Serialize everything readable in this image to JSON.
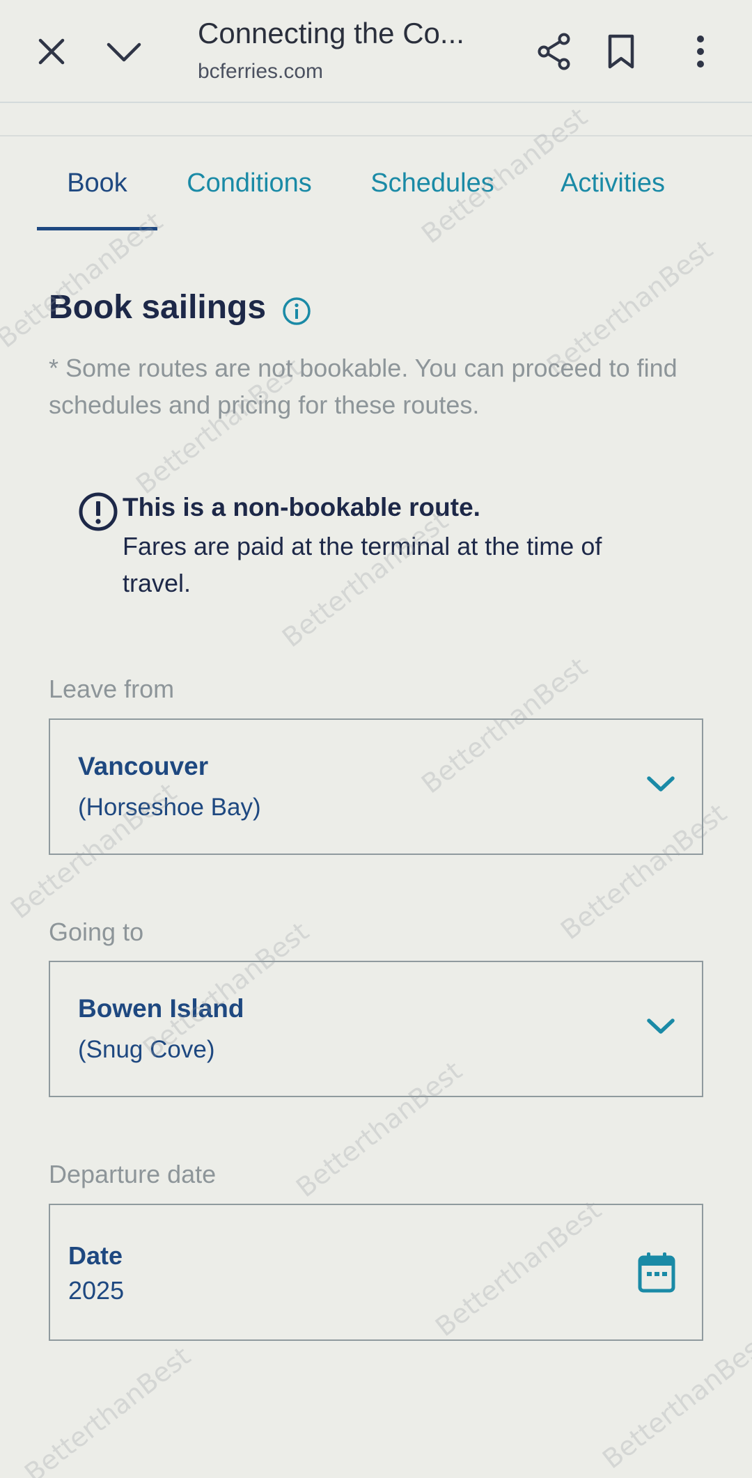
{
  "browser": {
    "page_title": "Connecting the Co...",
    "domain": "bcferries.com",
    "icons": [
      "close-icon",
      "chevron-down-icon",
      "share-icon",
      "bookmark-icon",
      "more-vert-icon"
    ]
  },
  "tabs": [
    {
      "label": "Book",
      "active": true
    },
    {
      "label": "Conditions",
      "active": false
    },
    {
      "label": "Schedules",
      "active": false
    },
    {
      "label": "Activities",
      "active": false
    }
  ],
  "book": {
    "heading": "Book sailings",
    "note": "* Some routes are not bookable. You can proceed to find schedules and pricing for these routes.",
    "alert": {
      "title": "This is a non-bookable route.",
      "body": "Fares are paid at the terminal at the time of travel."
    },
    "leave_from": {
      "label": "Leave from",
      "value": "Vancouver",
      "detail": "(Horseshoe Bay)"
    },
    "going_to": {
      "label": "Going to",
      "value": "Bowen Island",
      "detail": "(Snug Cove)"
    },
    "departure": {
      "label": "Departure date",
      "value": "Date",
      "detail": "2025"
    }
  },
  "watermark": "BetterthanBest",
  "colors": {
    "background": "#ecede8",
    "tab_active": "#1e4880",
    "tab_inactive": "#1a8aa6",
    "heading": "#1d2848",
    "muted": "#8d9599",
    "field_text": "#1e4880"
  }
}
